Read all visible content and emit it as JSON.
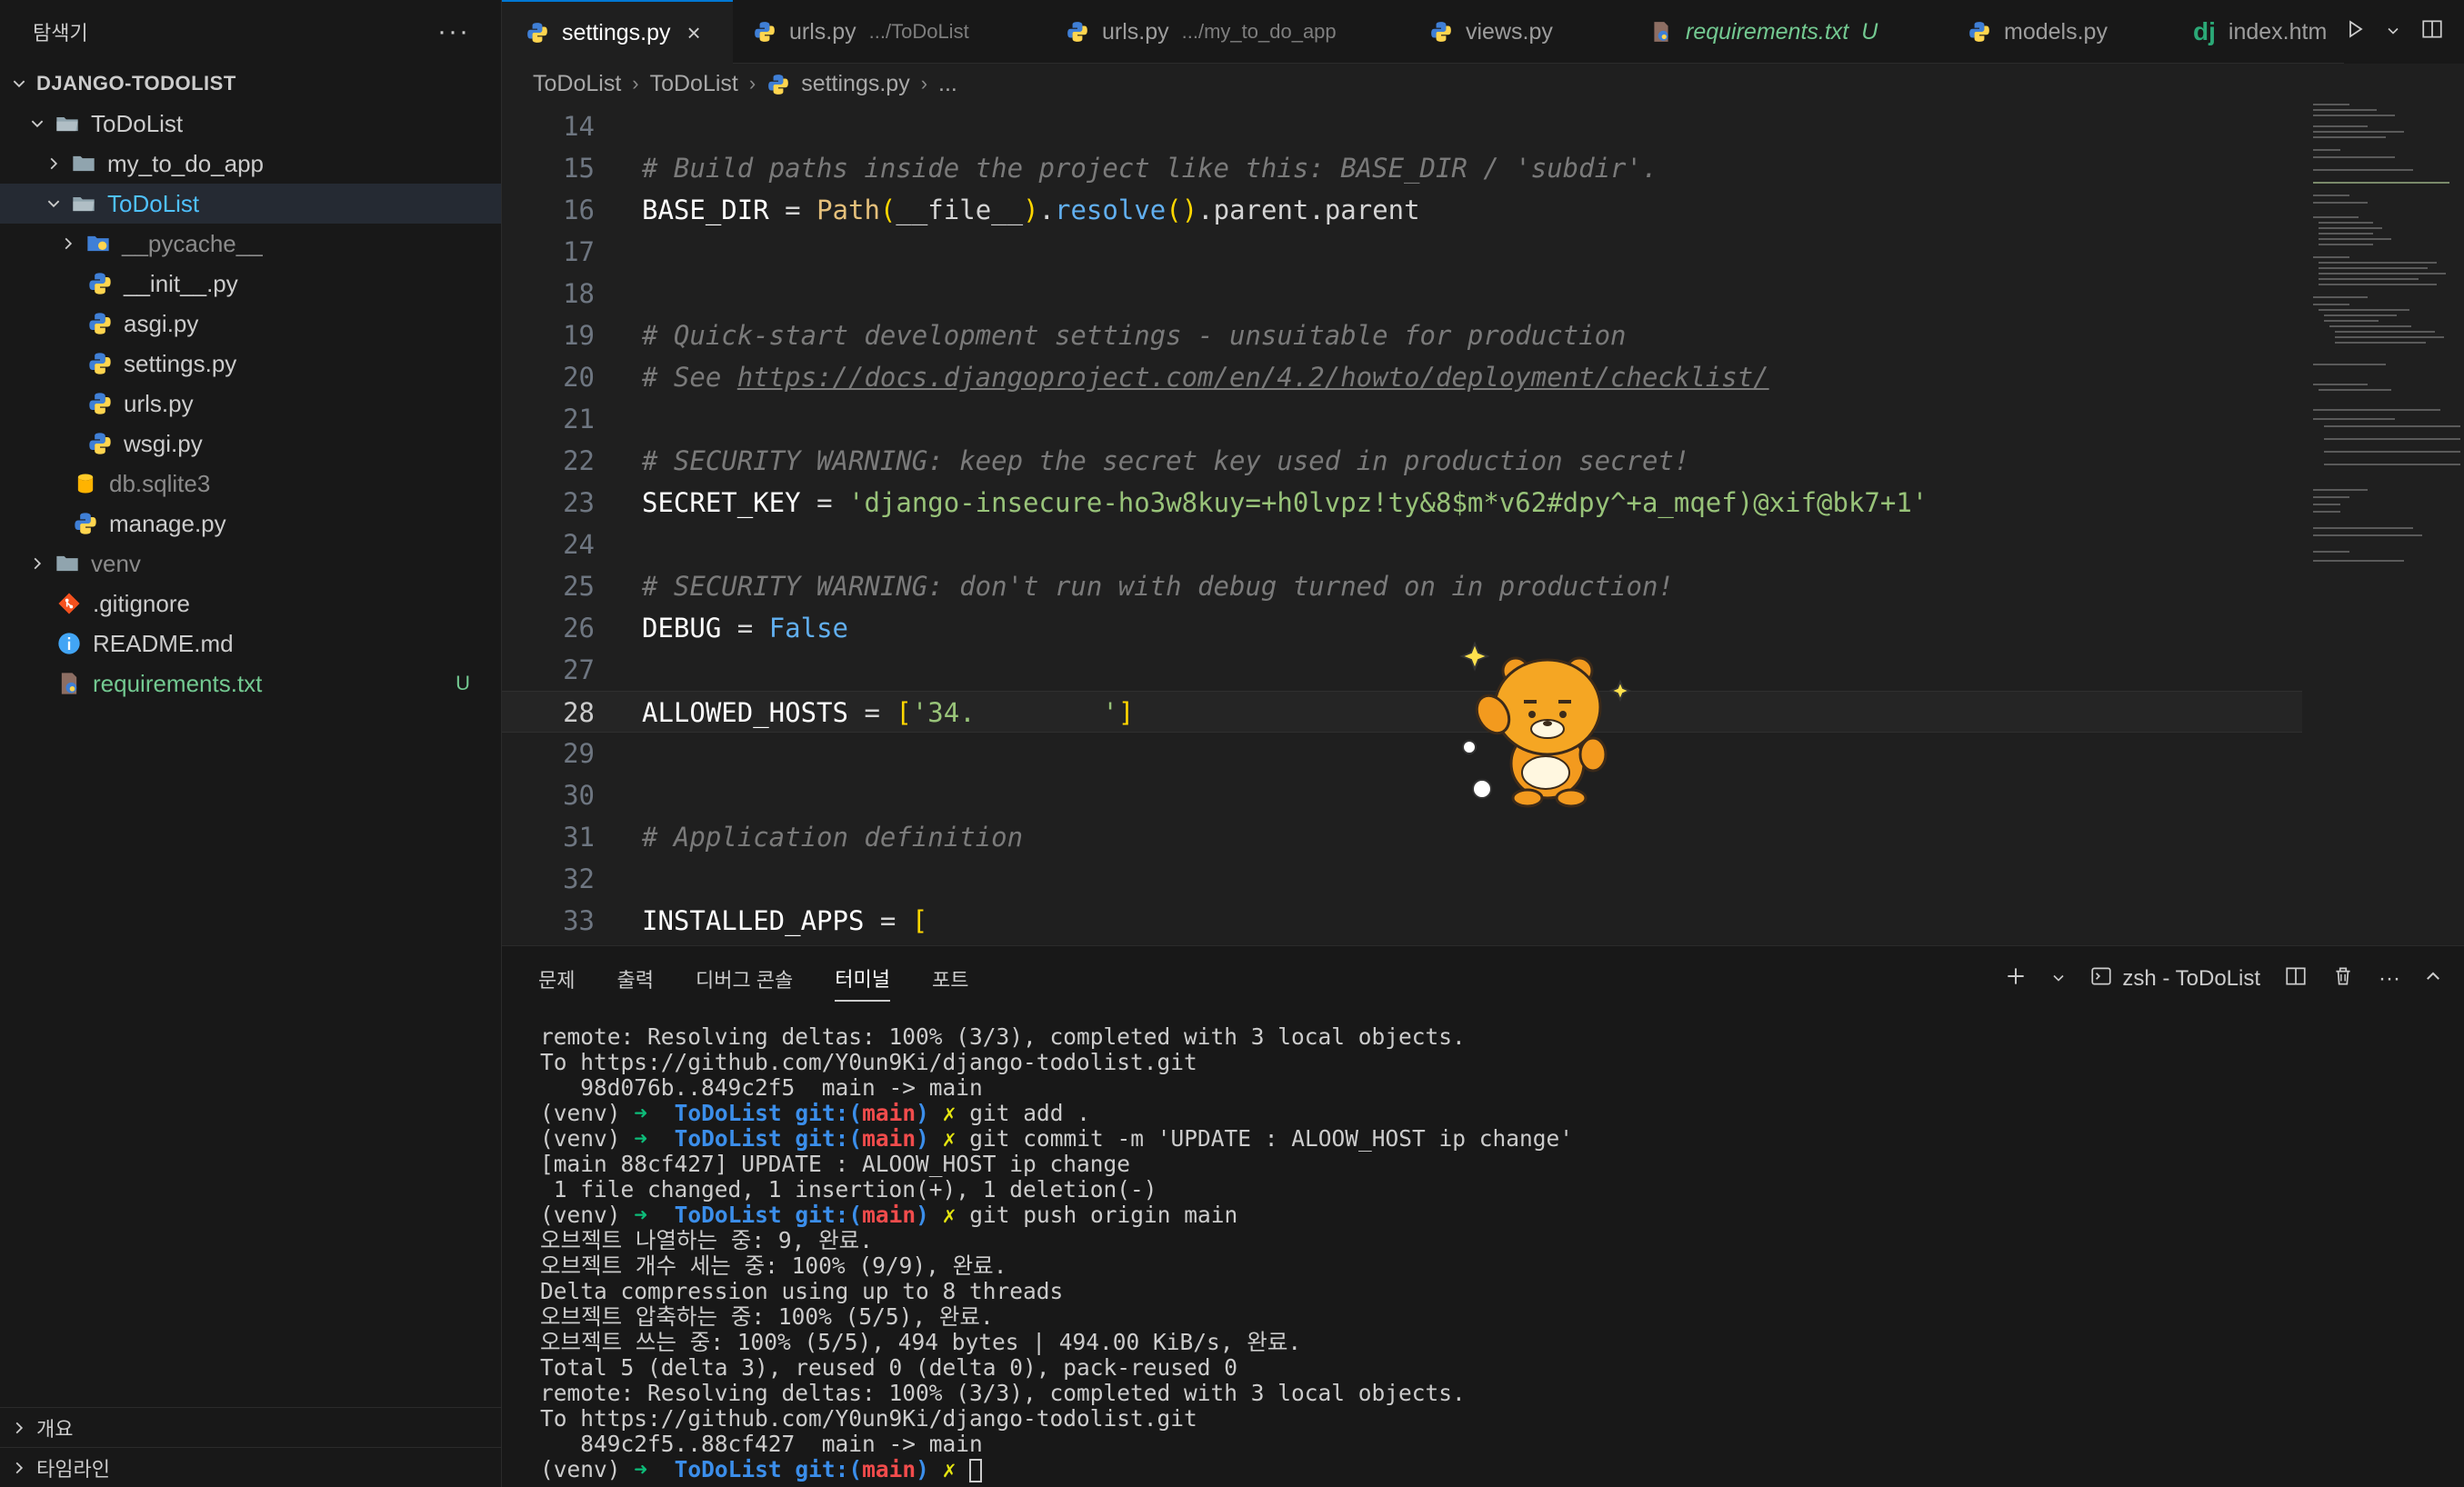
{
  "sidebar": {
    "title": "탐색기",
    "more": "···",
    "items": [
      {
        "label": "DJANGO-TODOLIST"
      },
      {
        "label": "ToDoList"
      },
      {
        "label": "my_to_do_app"
      },
      {
        "label": "ToDoList"
      },
      {
        "label": "__pycache__"
      },
      {
        "label": "__init__.py"
      },
      {
        "label": "asgi.py"
      },
      {
        "label": "settings.py"
      },
      {
        "label": "urls.py"
      },
      {
        "label": "wsgi.py"
      },
      {
        "label": "db.sqlite3"
      },
      {
        "label": "manage.py"
      },
      {
        "label": "venv"
      },
      {
        "label": ".gitignore"
      },
      {
        "label": "README.md"
      },
      {
        "label": "requirements.txt",
        "badge": "U"
      }
    ],
    "outline": "개요",
    "timeline": "타임라인"
  },
  "tabs": [
    {
      "label": "settings.py",
      "close": "×"
    },
    {
      "label": "urls.py",
      "desc": ".../ToDoList"
    },
    {
      "label": "urls.py",
      "desc": ".../my_to_do_app"
    },
    {
      "label": "views.py"
    },
    {
      "label": "requirements.txt",
      "badge": "U"
    },
    {
      "label": "models.py"
    },
    {
      "label": "index.htm",
      "prefix": "dj"
    }
  ],
  "breadcrumb": [
    "ToDoList",
    "ToDoList",
    "settings.py",
    "..."
  ],
  "code": {
    "lines": [
      {
        "n": "14"
      },
      {
        "n": "15",
        "comment": "# Build paths inside the project like this: BASE_DIR / 'subdir'."
      },
      {
        "n": "16",
        "var": "BASE_DIR",
        "eq": " = ",
        "cls": "Path",
        "arg": "__file__",
        "fn": "resolve",
        "tail": "parent.parent"
      },
      {
        "n": "17"
      },
      {
        "n": "18"
      },
      {
        "n": "19",
        "comment": "# Quick-start development settings - unsuitable for production"
      },
      {
        "n": "20",
        "comment_prefix": "# See ",
        "link": "https://docs.djangoproject.com/en/4.2/howto/deployment/checklist/"
      },
      {
        "n": "21"
      },
      {
        "n": "22",
        "comment": "# SECURITY WARNING: keep the secret key used in production secret!"
      },
      {
        "n": "23",
        "var": "SECRET_KEY",
        "eq": " = ",
        "str": "'django-insecure-ho3w8kuy=+h0lvpz!ty&8$m*v62#dpy^+a_mqef)@xif@bk7+1'"
      },
      {
        "n": "24"
      },
      {
        "n": "25",
        "comment": "# SECURITY WARNING: don't run with debug turned on in production!"
      },
      {
        "n": "26",
        "var": "DEBUG",
        "eq": " = ",
        "bool": "False"
      },
      {
        "n": "27"
      },
      {
        "n": "28",
        "var": "ALLOWED_HOSTS",
        "eq": " = ",
        "open": "[",
        "str": "'34.",
        "close": "]"
      },
      {
        "n": "29"
      },
      {
        "n": "30"
      },
      {
        "n": "31",
        "comment": "# Application definition"
      },
      {
        "n": "32"
      },
      {
        "n": "33",
        "var": "INSTALLED_APPS",
        "eq": " = ",
        "open": "["
      }
    ]
  },
  "panel": {
    "tabs": [
      "문제",
      "출력",
      "디버그 콘솔",
      "터미널",
      "포트"
    ],
    "active_tab": "터미널",
    "terminal_name": "zsh - ToDoList",
    "more": "···",
    "lines": [
      "remote: Resolving deltas: 100% (3/3), completed with 3 local objects.",
      "To https://github.com/Y0un9Ki/django-todolist.git",
      "   98d076b..849c2f5  main -> main",
      {
        "prompt": true,
        "cmd": "git add ."
      },
      {
        "prompt": true,
        "cmd": "git commit -m 'UPDATE : ALOOW_HOST ip change'"
      },
      "[main 88cf427] UPDATE : ALOOW_HOST ip change",
      " 1 file changed, 1 insertion(+), 1 deletion(-)",
      {
        "prompt": true,
        "cmd": "git push origin main"
      },
      "오브젝트 나열하는 중: 9, 완료.",
      "오브젝트 개수 세는 중: 100% (9/9), 완료.",
      "Delta compression using up to 8 threads",
      "오브젝트 압축하는 중: 100% (5/5), 완료.",
      "오브젝트 쓰는 중: 100% (5/5), 494 bytes | 494.00 KiB/s, 완료.",
      "Total 5 (delta 3), reused 0 (delta 0), pack-reused 0",
      "remote: Resolving deltas: 100% (3/3), completed with 3 local objects.",
      "To https://github.com/Y0un9Ki/django-todolist.git",
      "   849c2f5..88cf427  main -> main",
      {
        "prompt": true,
        "cmd": "",
        "cursor": true
      }
    ],
    "prompt": {
      "venv": "(venv)",
      "arrow": "➜",
      "dir": "ToDoList",
      "git": "git:(",
      "branch": "main",
      "git_close": ")",
      "x": "✗"
    }
  }
}
